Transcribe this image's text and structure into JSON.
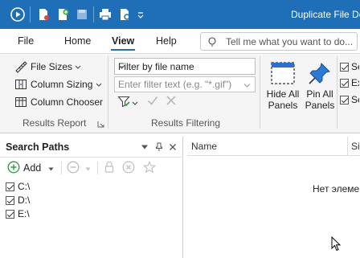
{
  "app": {
    "window_title": "Duplicate File De",
    "quick_access": [
      "play-icon",
      "new-search-icon",
      "add-icon",
      "save-icon",
      "print-icon",
      "print-preview-icon",
      "customize-icon"
    ]
  },
  "menu": {
    "items": [
      {
        "label": "File",
        "active": false
      },
      {
        "label": "Home",
        "active": false
      },
      {
        "label": "View",
        "active": true
      },
      {
        "label": "Help",
        "active": false
      }
    ],
    "tell_me_placeholder": "Tell me what you want to do..."
  },
  "ribbon": {
    "results_report": {
      "file_sizes": "File Sizes",
      "column_sizing": "Column Sizing",
      "column_chooser": "Column Chooser",
      "group_label": "Results Report"
    },
    "results_filtering": {
      "filter_mode": "Filter by file name",
      "filter_placeholder": "Enter filter text (e.g. \"*.gif\")",
      "group_label": "Results Filtering"
    },
    "panels": {
      "hide_all": {
        "line1": "Hide All",
        "line2": "Panels"
      },
      "pin_all": {
        "line1": "Pin All",
        "line2": "Panels"
      }
    },
    "checkboxes": [
      {
        "label": "Se",
        "checked": true
      },
      {
        "label": "Ex",
        "checked": true
      },
      {
        "label": "Se",
        "checked": true
      }
    ]
  },
  "search_paths": {
    "title": "Search Paths",
    "add_label": "Add",
    "paths": [
      {
        "label": "C:\\",
        "checked": true
      },
      {
        "label": "D:\\",
        "checked": true
      },
      {
        "label": "E:\\",
        "checked": true
      }
    ]
  },
  "results": {
    "columns": [
      "Name",
      "Si"
    ],
    "empty_message": "Нет элеме"
  },
  "colors": {
    "titlebar": "#1f6fb8",
    "accent_green": "#2e9a3e",
    "ribbon_bg": "#f5f5f5"
  }
}
